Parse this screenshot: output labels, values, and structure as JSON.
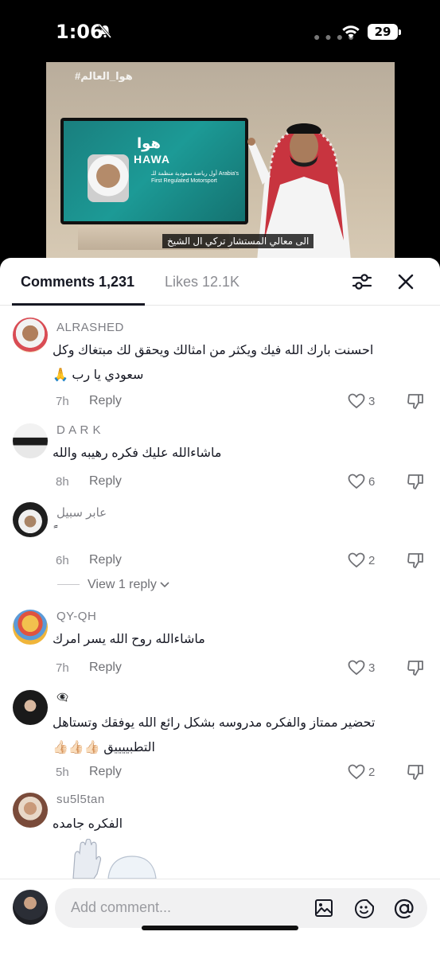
{
  "status_bar": {
    "time": "1:06",
    "battery": "29"
  },
  "video": {
    "hashtag": "#هوا_العالم",
    "tv_title_ar": "هوا",
    "tv_title": "HAWA",
    "tv_subtitle": "أول رياضة سعودية منظمة للـ Arabia's First Regulated Motorsport",
    "caption": "الى معالي المستشار تركي ال الشيخ"
  },
  "tabs": {
    "comments_label": "Comments 1,231",
    "likes_label": "Likes 12.1K"
  },
  "comments": [
    {
      "username": "ALRASHED",
      "text": "احسنت بارك الله فيك ويكثر من امثالك ويحقق لك مبتغاك وكل سعودي يا رب 🙏",
      "time": "7h",
      "reply": "Reply",
      "likes": "3"
    },
    {
      "username": "D A R K",
      "text": "ماشاءالله عليك فكره رهيبه والله",
      "time": "8h",
      "reply": "Reply",
      "likes": "6"
    },
    {
      "username": "عابر سبيل",
      "text": "ً",
      "time": "6h",
      "reply": "Reply",
      "likes": "2",
      "view_replies": "View 1 reply"
    },
    {
      "username": "QY-QH",
      "text": "ماشاءالله روح الله يسر امرك",
      "time": "7h",
      "reply": "Reply",
      "likes": "3"
    },
    {
      "username": "👁‍🗨",
      "text": "تحضير ممتاز والفكره مدروسه بشكل رائع الله يوفقك وتستاهل التطبييييق 👍🏻👍🏻👍🏻",
      "time": "5h",
      "reply": "Reply",
      "likes": "2"
    },
    {
      "username": "su5l5tan",
      "text": "الفكره جامده"
    }
  ],
  "input": {
    "placeholder": "Add comment..."
  },
  "colors": {
    "text_primary": "#161823",
    "text_secondary": "#8a8b91",
    "divider": "#e6e6e6"
  }
}
